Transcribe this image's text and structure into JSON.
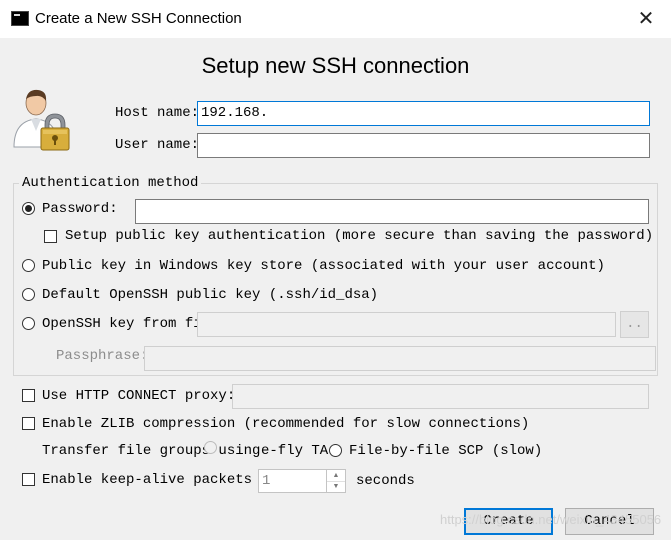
{
  "window": {
    "title": "Create a New SSH Connection",
    "close_glyph": "✕"
  },
  "heading": "Setup new SSH connection",
  "host": {
    "label": "Host name:",
    "value": "192.168."
  },
  "user": {
    "label": "User name:",
    "value": ""
  },
  "auth": {
    "group_label": "Authentication method",
    "password_label": "Password:",
    "password_value": "",
    "setup_pubkey_label": "Setup public key authentication (more secure than saving the password)",
    "windows_keystore_label": "Public key in Windows key store (associated with your user account)",
    "default_openssh_label": "Default OpenSSH public key (.ssh/id_dsa)",
    "openssh_file_label": "OpenSSH key from file:",
    "openssh_file_value": "",
    "browse_label": "..",
    "passphrase_label": "Passphrase:",
    "passphrase_value": "",
    "selected": "password"
  },
  "http_proxy": {
    "label": "Use HTTP CONNECT proxy:",
    "value": ""
  },
  "zlib": {
    "label": "Enable ZLIB compression (recommended for slow connections)"
  },
  "transfer": {
    "label": "Transfer file groups using:",
    "option1_label": "e-fly TA",
    "option2_label": "File-by-file SCP (slow)"
  },
  "keepalive": {
    "label": "Enable keep-alive packets e",
    "value": "1",
    "suffix": "seconds"
  },
  "buttons": {
    "create": "Create",
    "cancel": "Cancel"
  },
  "watermark": "https://blog.csdn.net/weixin_43455056",
  "icons": {
    "user_lock": "user-lock-icon",
    "app": "terminal-icon"
  }
}
